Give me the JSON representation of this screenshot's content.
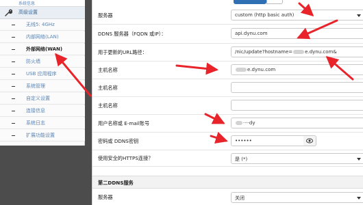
{
  "sidebar": {
    "top_label": "系统信息",
    "section_label": "高级设置",
    "items": [
      {
        "label": "无线5: 4GHz",
        "active": false
      },
      {
        "label": "内部网络(LAN)",
        "active": false
      },
      {
        "label": "外部网络(WAN)",
        "active": true
      },
      {
        "label": "防火墙",
        "active": false
      },
      {
        "label": "USB 应用程序",
        "active": false
      },
      {
        "label": "系统管理",
        "active": false
      },
      {
        "label": "自定义设置",
        "active": false
      },
      {
        "label": "连接信息",
        "active": false
      },
      {
        "label": "系统日志",
        "active": false
      },
      {
        "label": "扩展功能设置",
        "active": false
      }
    ]
  },
  "form": {
    "server_label": "服务器",
    "server_value": "custom (http basic auth)",
    "ddns_label": "DDNS 服务器（FQDN 或IP）：",
    "ddns_value": "api.dynu.com",
    "url_label": "用于更新的URL路径：",
    "url_value_a": "/nic/update?hostname=",
    "url_value_b": "e.dynu.com&",
    "host1_label": "主机名称",
    "host1_value": "e.dynu.com",
    "host2_label": "主机名称",
    "host2_value": "",
    "host3_label": "主机名称",
    "host3_value": "",
    "user_label": "用户名称或 E-mail账号",
    "user_value": "····dy",
    "pass_label": "密码或 DDNS密钥",
    "pass_value": "••••••",
    "https_label": "使用安全的HTTPS连接？",
    "https_value": "是 (*)",
    "section2_label": "第二DDNS服务",
    "server2_label": "服务器",
    "server2_value": "关闭"
  },
  "colors": {
    "arrow": "#e8232a",
    "accent": "#2f6fb3"
  },
  "icons": {
    "settings": "wrench-icon",
    "show_password": "eye-icon"
  }
}
